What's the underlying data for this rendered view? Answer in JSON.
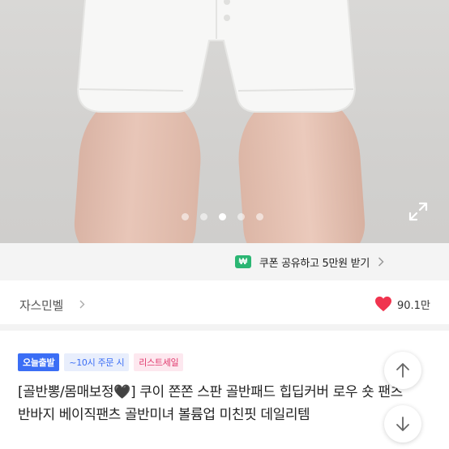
{
  "gallery": {
    "slide_count": 5,
    "active_slide": 3,
    "expand_icon": "expand-icon"
  },
  "coupon": {
    "badge": "₩",
    "text": "쿠폰 공유하고 5만원 받기",
    "icon": "chevron-right-icon"
  },
  "shop": {
    "name": "자스민벨",
    "likes": "90.1만",
    "like_icon": "heart-icon",
    "like_color": "#f0344f"
  },
  "tags": {
    "today": "오늘출발",
    "order_time": "~10시 주문 시",
    "sale": "리스트세일"
  },
  "product": {
    "title": "[골반뽕/몸매보정🖤] 쿠이 쫀쫀 스판 골반패드 힙딥커버 로우 숏 팬츠 반바지 베이직팬츠 골반미녀 볼륨업 미친핏 데일리템"
  },
  "floating": {
    "up_icon": "arrow-up-icon",
    "down_icon": "arrow-down-icon"
  }
}
